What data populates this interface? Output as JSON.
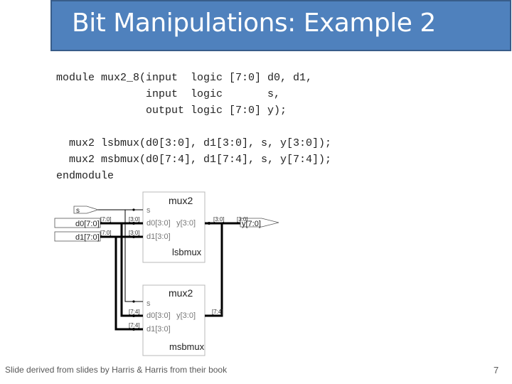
{
  "slide": {
    "title": "Bit Manipulations: Example 2",
    "code_lines": [
      "module mux2_8(input  logic [7:0] d0, d1,",
      "              input  logic       s,",
      "              output logic [7:0] y);",
      "",
      "  mux2 lsbmux(d0[3:0], d1[3:0], s, y[3:0]);",
      "  mux2 msbmux(d0[7:4], d1[7:4], s, y[7:4]);",
      "endmodule"
    ],
    "footer": "Slide derived from slides by Harris & Harris from their book",
    "page_number": "7"
  },
  "diagram": {
    "ports": {
      "s": "s",
      "d0": "d0[7:0]",
      "d1": "d1[7:0]",
      "y": "y[7:0]"
    },
    "bus_labels": {
      "d0_in": "[7:0]",
      "d1_in": "[7:0]",
      "lsb_d0": "[3:0]",
      "lsb_d1": "[3:0]",
      "lsb_y": "[3:0]",
      "y_out": "[3:0]",
      "msb_d0": "[7:4]",
      "msb_d1": "[7:4]",
      "msb_y": "[7:4]"
    },
    "blocks": [
      {
        "type": "mux2",
        "instance": "lsbmux",
        "pins": {
          "s": "s",
          "d0": "d0[3:0]",
          "d1": "d1[3:0]",
          "y": "y[3:0]"
        }
      },
      {
        "type": "mux2",
        "instance": "msbmux",
        "pins": {
          "s": "s",
          "d0": "d0[3:0]",
          "d1": "d1[3:0]",
          "y": "y[3:0]"
        }
      }
    ]
  }
}
